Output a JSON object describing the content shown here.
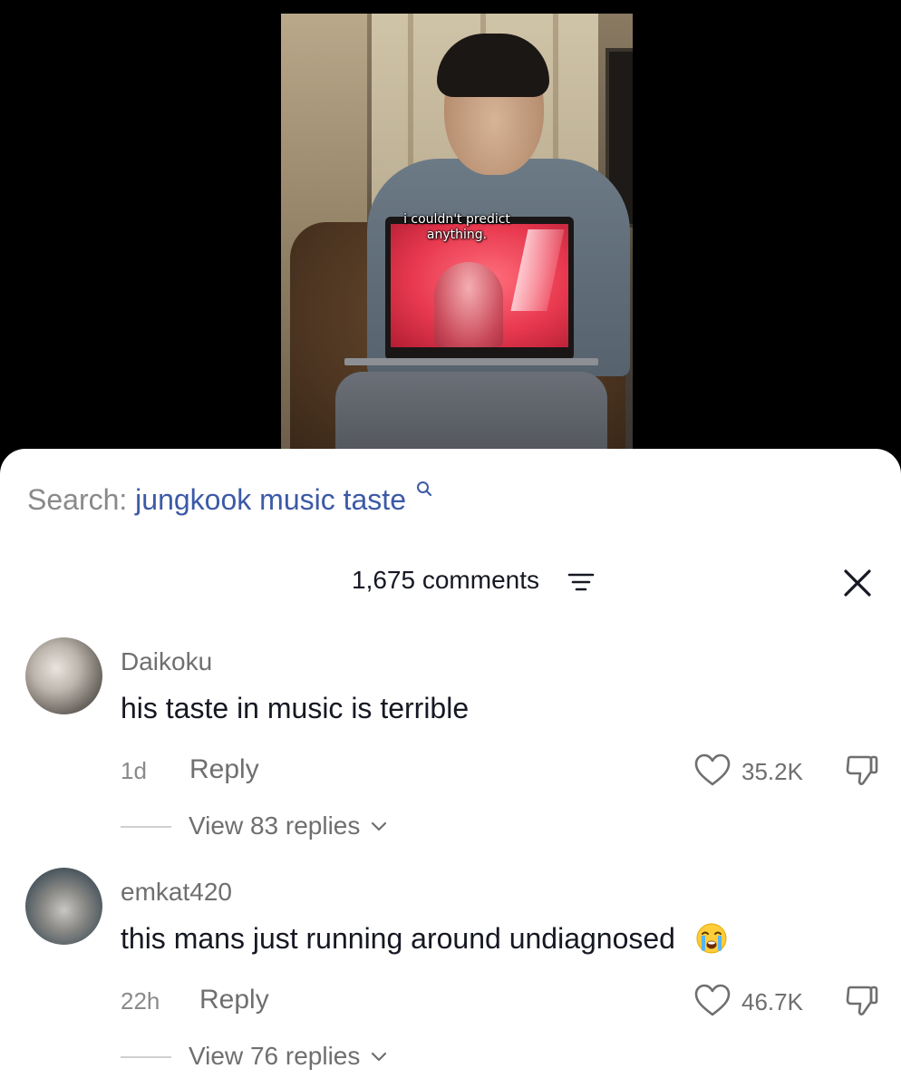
{
  "video": {
    "caption_line1": "i couldn't predict",
    "caption_line2": "anything."
  },
  "search": {
    "prefix": "Search:",
    "query": "jungkook music taste"
  },
  "comments_header": {
    "count_label": "1,675 comments"
  },
  "comments": [
    {
      "username": "Daikoku",
      "text": "his taste in music is terrible",
      "time": "1d",
      "reply_label": "Reply",
      "likes": "35.2K",
      "view_replies": "View 83 replies"
    },
    {
      "username": "emkat420",
      "text": "this mans just running around undiagnosed",
      "emoji": "loudly-crying-face",
      "time": "22h",
      "reply_label": "Reply",
      "likes": "46.7K",
      "view_replies": "View 76 replies"
    }
  ],
  "colors": {
    "search_query": "#3c5aa6",
    "muted_text": "#6f6f6f",
    "primary_text": "#161823"
  }
}
